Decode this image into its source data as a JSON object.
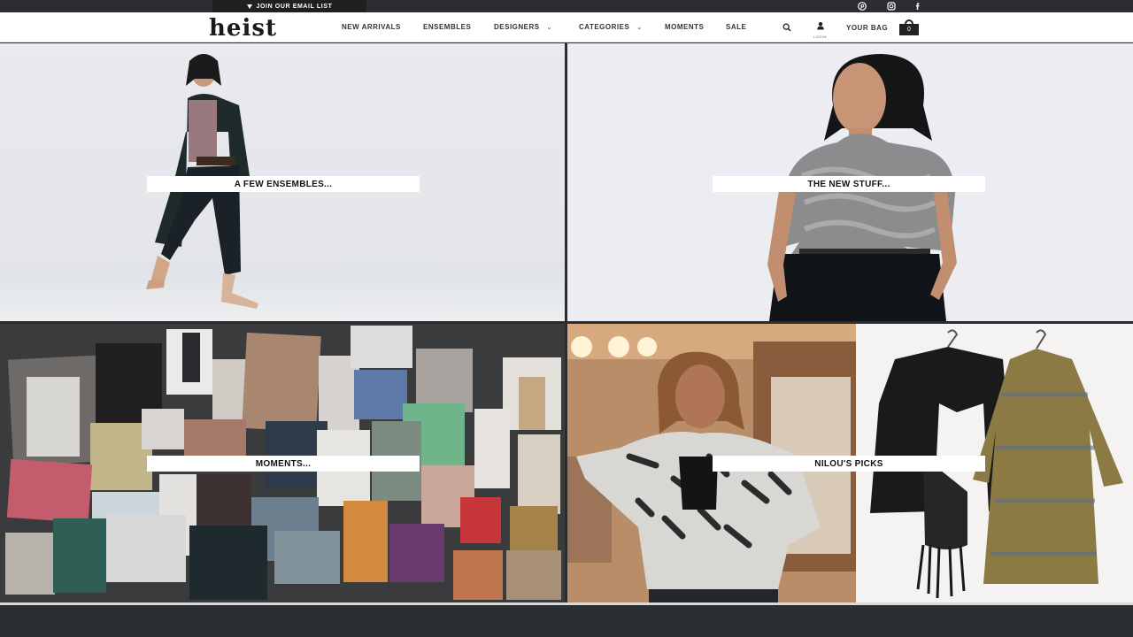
{
  "topbar": {
    "email_label": "JOIN OUR EMAIL LIST",
    "social": [
      "pinterest-icon",
      "instagram-icon",
      "facebook-icon"
    ]
  },
  "nav": {
    "logo": "heist",
    "links": [
      "NEW ARRIVALS",
      "ENSEMBLES",
      "DESIGNERS",
      "CATEGORIES",
      "MOMENTS",
      "SALE"
    ],
    "login_label": "LOGIN",
    "bag_label": "YOUR BAG",
    "bag_count": "0"
  },
  "tiles": {
    "ensembles": "A FEW ENSEMBLES...",
    "new_stuff": "THE NEW STUFF...",
    "moments": "MOMENTS...",
    "picks": "NILOU'S PICKS"
  },
  "colors": {
    "topbar": "#2b2d30",
    "nav_bg": "#ffffff",
    "label_bg": "#ffffff",
    "footer": "#2c2f31"
  }
}
